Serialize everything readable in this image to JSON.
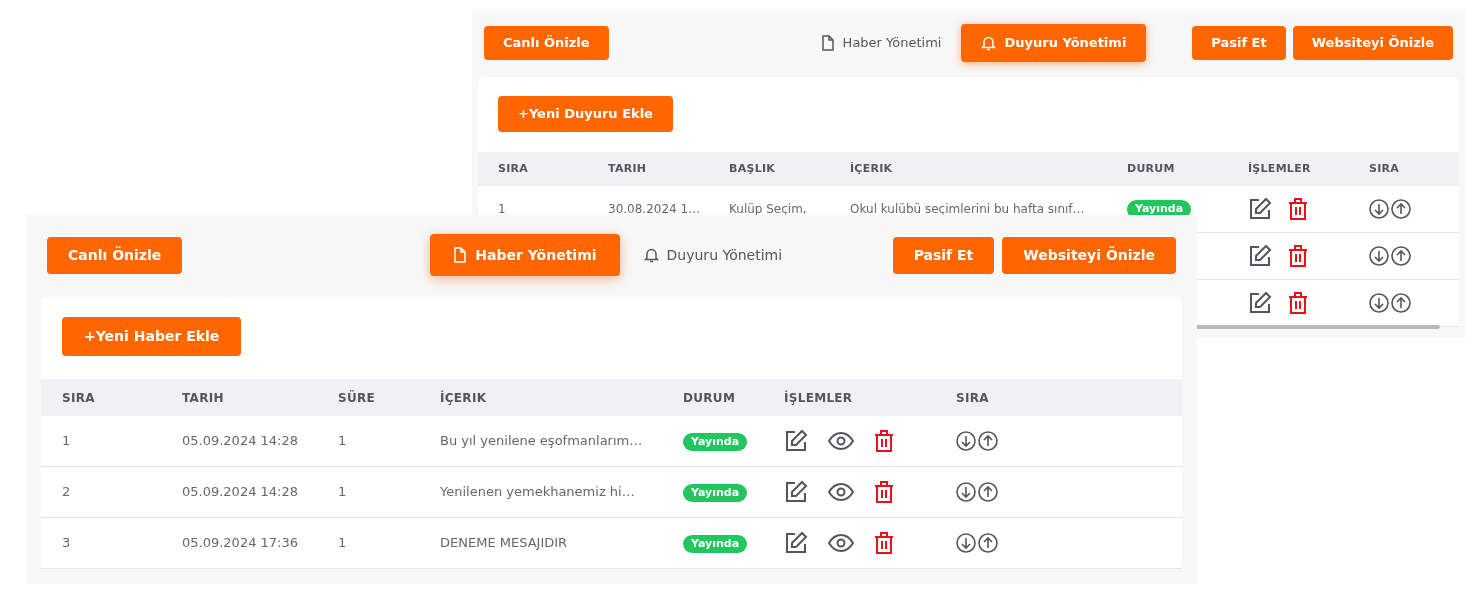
{
  "windows": [
    {
      "kind": "back",
      "header": {
        "left_button": "Canlı Önizle",
        "tabs": [
          {
            "label": "Haber Yönetimi",
            "selected": false
          },
          {
            "label": "Duyuru Yönetimi",
            "selected": true
          }
        ],
        "right_buttons": [
          "Pasif Et",
          "Websiteyi Önizle"
        ]
      },
      "add_button": "+Yeni Duyuru Ekle",
      "table": {
        "columns": [
          "SIRA",
          "TARIH",
          "BAŞLIK",
          "İÇERIK",
          "DURUM",
          "İŞLEMLER",
          "SIRA"
        ],
        "rows": [
          {
            "kind": "full",
            "cells": [
              "1",
              "30.08.2024 1…",
              "Kulüp Seçim,",
              "Okul kulübü seçimlerini bu hafta sınıf…"
            ],
            "status": "Yayında"
          },
          {
            "kind": "covered"
          },
          {
            "kind": "covered"
          }
        ]
      }
    },
    {
      "kind": "front",
      "header": {
        "left_button": "Canlı Önizle",
        "tabs": [
          {
            "label": "Haber Yönetimi",
            "selected": true
          },
          {
            "label": "Duyuru Yönetimi",
            "selected": false
          }
        ],
        "right_buttons": [
          "Pasif Et",
          "Websiteyi Önizle"
        ]
      },
      "add_button": "+Yeni Haber Ekle",
      "table": {
        "columns": [
          "SIRA",
          "TARIH",
          "SÜRE",
          "İÇERIK",
          "DURUM",
          "İŞLEMLER",
          "SIRA"
        ],
        "rows": [
          {
            "kind": "full",
            "cells": [
              "1",
              "05.09.2024 14:28",
              "1",
              "Bu yıl yenilene eşofmanlarım…"
            ],
            "status": "Yayında"
          },
          {
            "kind": "full",
            "cells": [
              "2",
              "05.09.2024 14:28",
              "1",
              "Yenilenen yemekhanemiz hi…"
            ],
            "status": "Yayında"
          },
          {
            "kind": "full",
            "cells": [
              "3",
              "05.09.2024 17:36",
              "1",
              "DENEME MESAJIDIR"
            ],
            "status": "Yayında"
          }
        ]
      }
    }
  ]
}
